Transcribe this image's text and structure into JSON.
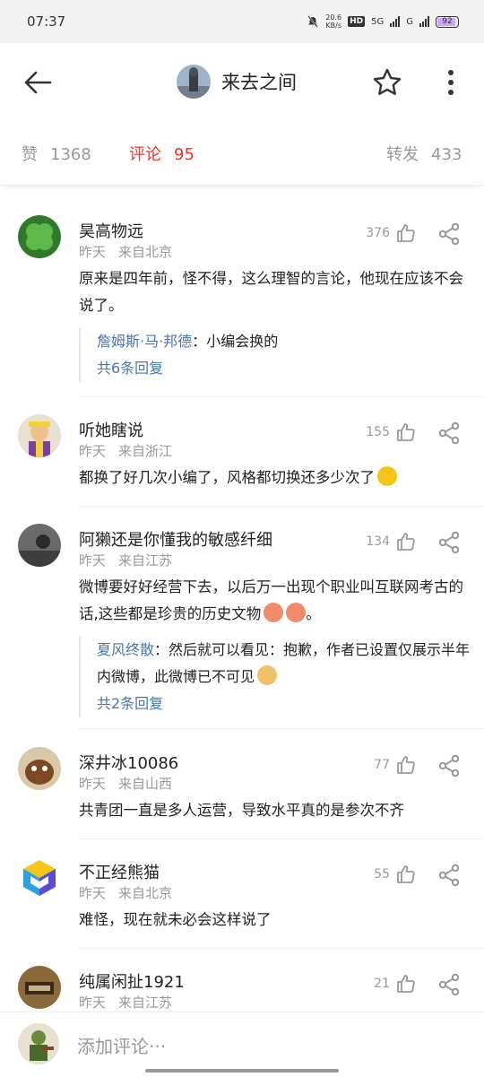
{
  "status_bar": {
    "time": "07:37",
    "net_speed": "20.6",
    "net_unit": "KB/s",
    "hd": "HD",
    "sim1": "5G",
    "sim2": "G",
    "battery": "92"
  },
  "header": {
    "title": "来去之间",
    "back_icon": "back-arrow-icon",
    "star_icon": "star-icon",
    "more_icon": "more-vertical-icon"
  },
  "tabs": {
    "likes_label": "赞",
    "likes_count": "1368",
    "comments_label": "评论",
    "comments_count": "95",
    "reposts_label": "转发",
    "reposts_count": "433"
  },
  "comments": [
    {
      "name": "昊高物远",
      "time": "昨天",
      "location": "来自北京",
      "likes": "376",
      "text": "原来是四年前，怪不得，这么理智的言论，他现在应该不会说了。",
      "reply_name": "詹姆斯·马·邦德",
      "reply_text": "：小编会换的",
      "more_replies": "共6条回复"
    },
    {
      "name": "听她瞎说",
      "time": "昨天",
      "location": "来自浙江",
      "likes": "155",
      "text": "都换了好几次小编了，风格都切换还多少次了"
    },
    {
      "name": "阿獭还是你懂我的敏感纤细",
      "time": "昨天",
      "location": "来自江苏",
      "likes": "134",
      "text": "微博要好好经营下去，以后万一出现个职业叫互联网考古的话,这些都是珍贵的历史文物",
      "text_end": "。",
      "reply_name": "夏风终散",
      "reply_text": "：然后就可以看见：抱歉，作者已设置仅展示半年内微博，此微博已不可见",
      "more_replies": "共2条回复"
    },
    {
      "name": "深井冰10086",
      "time": "昨天",
      "location": "来自山西",
      "likes": "77",
      "text": "共青团一直是多人运营，导致水平真的是参次不齐"
    },
    {
      "name": "不正经熊猫",
      "time": "昨天",
      "location": "来自北京",
      "likes": "55",
      "text": "难怪，现在就未必会这样说了"
    },
    {
      "name": "纯属闲扯1921",
      "time": "昨天",
      "location": "来自江苏",
      "likes": "21"
    }
  ],
  "bottom_bar": {
    "placeholder": "添加评论···"
  },
  "colors": {
    "accent": "#e3372f",
    "link": "#4a76a8",
    "muted": "#999999"
  }
}
